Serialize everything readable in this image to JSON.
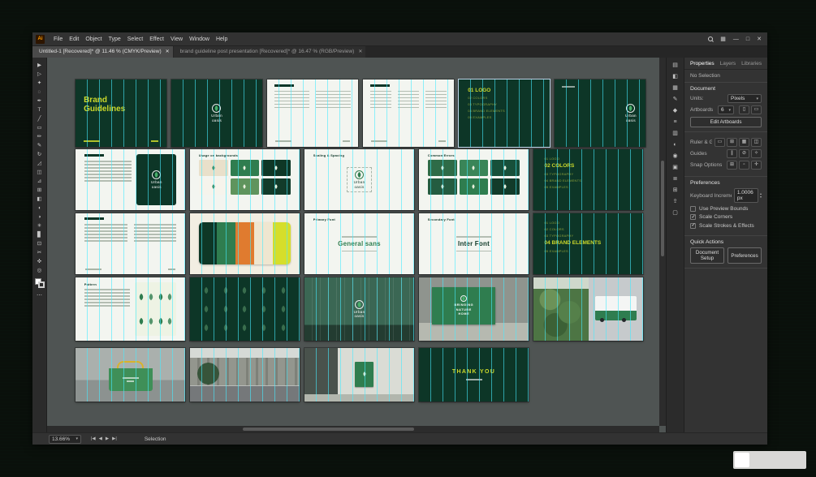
{
  "titlebar": {
    "app_icon_text": "Ai",
    "menus": [
      "File",
      "Edit",
      "Object",
      "Type",
      "Select",
      "Effect",
      "View",
      "Window",
      "Help"
    ]
  },
  "tabs": [
    {
      "label": "Untitled-1 [Recovered]* @ 11.46 % (CMYK/Preview)",
      "active": true
    },
    {
      "label": "brand guideline post presentation [Recovered]* @ 16.47 % (RGB/Preview)",
      "active": false
    }
  ],
  "toolbar": {
    "tools": [
      {
        "name": "selection-tool",
        "glyph": "▶"
      },
      {
        "name": "direct-selection-tool",
        "glyph": "▷"
      },
      {
        "name": "magic-wand-tool",
        "glyph": "✦"
      },
      {
        "name": "lasso-tool",
        "glyph": "◌"
      },
      {
        "name": "pen-tool",
        "glyph": "✒"
      },
      {
        "name": "type-tool",
        "glyph": "T"
      },
      {
        "name": "line-segment-tool",
        "glyph": "╱"
      },
      {
        "name": "rectangle-tool",
        "glyph": "▭"
      },
      {
        "name": "paintbrush-tool",
        "glyph": "✏"
      },
      {
        "name": "pencil-tool",
        "glyph": "✎"
      },
      {
        "name": "rotate-tool",
        "glyph": "↻"
      },
      {
        "name": "scale-tool",
        "glyph": "◿"
      },
      {
        "name": "shape-builder-tool",
        "glyph": "◫"
      },
      {
        "name": "perspective-grid-tool",
        "glyph": "⊿"
      },
      {
        "name": "mesh-tool",
        "glyph": "⊞"
      },
      {
        "name": "gradient-tool",
        "glyph": "◧"
      },
      {
        "name": "eyedropper-tool",
        "glyph": "◖"
      },
      {
        "name": "blend-tool",
        "glyph": "◑"
      },
      {
        "name": "symbol-sprayer-tool",
        "glyph": "✳"
      },
      {
        "name": "column-graph-tool",
        "glyph": "▊"
      },
      {
        "name": "artboard-tool",
        "glyph": "⊡"
      },
      {
        "name": "slice-tool",
        "glyph": "✂"
      },
      {
        "name": "hand-tool",
        "glyph": "✜"
      },
      {
        "name": "zoom-tool",
        "glyph": "◎"
      }
    ]
  },
  "dock_icons": [
    {
      "name": "color-panel-icon",
      "glyph": "▤"
    },
    {
      "name": "color-guide-panel-icon",
      "glyph": "◧"
    },
    {
      "name": "swatches-panel-icon",
      "glyph": "▦"
    },
    {
      "name": "brushes-panel-icon",
      "glyph": "✎"
    },
    {
      "name": "symbols-panel-icon",
      "glyph": "◆"
    },
    {
      "name": "stroke-panel-icon",
      "glyph": "≡"
    },
    {
      "name": "gradient-panel-icon",
      "glyph": "▥"
    },
    {
      "name": "transparency-panel-icon",
      "glyph": "◐"
    },
    {
      "name": "appearance-panel-icon",
      "glyph": "◉"
    },
    {
      "name": "graphic-styles-panel-icon",
      "glyph": "▣"
    },
    {
      "name": "layers-panel-icon",
      "glyph": "≣"
    },
    {
      "name": "artboards-panel-icon",
      "glyph": "⊞"
    },
    {
      "name": "asset-export-panel-icon",
      "glyph": "⇪"
    },
    {
      "name": "libraries-panel-icon",
      "glyph": "▢"
    }
  ],
  "panel": {
    "tabs": [
      "Properties",
      "Layers",
      "Libraries"
    ],
    "selection_status": "No Selection",
    "document": {
      "title": "Document",
      "units_label": "Units:",
      "units_value": "Pixels",
      "artboards_label": "Artboards",
      "artboards_value": "6",
      "artboard_icons": [
        {
          "name": "artboard-portrait-icon",
          "glyph": "▯"
        },
        {
          "name": "artboard-landscape-icon",
          "glyph": "▭"
        }
      ],
      "edit_artboards_label": "Edit Artboards"
    },
    "view": {
      "ruler_grids_label": "Ruler & Grids",
      "ruler_grids_icons": [
        {
          "name": "rulers-icon",
          "glyph": "▭"
        },
        {
          "name": "grid-icon",
          "glyph": "⊞"
        },
        {
          "name": "pixel-grid-icon",
          "glyph": "▦"
        },
        {
          "name": "transparency-grid-icon",
          "glyph": "◫"
        }
      ],
      "guides_label": "Guides",
      "guides_icons": [
        {
          "name": "show-guides-icon",
          "glyph": "∥"
        },
        {
          "name": "lock-guides-icon",
          "glyph": "⊘"
        },
        {
          "name": "smart-guides-icon",
          "glyph": "✧"
        }
      ],
      "snap_label": "Snap Options",
      "snap_icons": [
        {
          "name": "snap-to-grid-icon",
          "glyph": "⊞"
        },
        {
          "name": "snap-to-pixel-icon",
          "glyph": "▫"
        },
        {
          "name": "snap-to-point-icon",
          "glyph": "✛"
        }
      ]
    },
    "preferences": {
      "title": "Preferences",
      "keyboard_increment_label": "Keyboard Increment:",
      "keyboard_increment_value": "1.0006 px",
      "checkboxes": [
        {
          "label": "Use Preview Bounds",
          "checked": false
        },
        {
          "label": "Scale Corners",
          "checked": true
        },
        {
          "label": "Scale Strokes & Effects",
          "checked": true
        }
      ]
    },
    "quick_actions": {
      "title": "Quick Actions",
      "buttons": [
        "Document Setup",
        "Preferences"
      ]
    }
  },
  "statusbar": {
    "zoom": "13.66%",
    "status": "Selection"
  },
  "colors": {
    "desktop": "#0a100b",
    "chrome": "#323232",
    "canvas": "#4f5453",
    "brand_dark_green": "#0d3627",
    "brand_green": "#2f7d4f",
    "brand_yellow": "#ccd92b",
    "accent_orange": "#e07b2f",
    "guide_cyan": "#46ebff"
  },
  "brand": {
    "name_lines": [
      "Urban",
      "oasis"
    ],
    "sections": [
      "01 LOGO",
      "02 COLORS",
      "03 TYPOGRAPHY",
      "04 BRAND ELEMENTS",
      "05 EXAMPLES"
    ]
  },
  "usage_tiles": [
    "#e9e0ca",
    "#2f7d4f",
    "#0e3726",
    "#f6f4ec",
    "#5f945d",
    "#123b2a"
  ],
  "error_tiles": [
    "#2e6b47",
    "#3a8558",
    "#17503a",
    "#245c41",
    "#2f7d4f",
    "#123b2a"
  ],
  "swatch_colors": [
    "#0e3726",
    "#2f7d4f",
    "#e07b2f",
    "#efe6d0",
    "#d6de2a"
  ],
  "artboards": [
    {
      "id": "r1c1",
      "type": "title",
      "lines": [
        "Brand",
        "Guidelines"
      ]
    },
    {
      "id": "r1c2",
      "type": "logo_center"
    },
    {
      "id": "r1c3",
      "type": "doc_white",
      "columns": 2
    },
    {
      "id": "r1c4",
      "type": "doc_white",
      "columns": 3
    },
    {
      "id": "r1c5",
      "type": "divider",
      "active": 0,
      "selected": true
    },
    {
      "id": "r1c6",
      "type": "logo_right"
    },
    {
      "id": "r2c1",
      "type": "rationale"
    },
    {
      "id": "r2c2",
      "type": "usage",
      "title": "Usage on backgrounds"
    },
    {
      "id": "r2c3",
      "type": "scaling",
      "title": "Scaling & Spacing"
    },
    {
      "id": "r2c4",
      "type": "errors",
      "title": "Common Errors"
    },
    {
      "id": "r2c5",
      "type": "divider",
      "active": 1
    },
    {
      "id": "r3c1",
      "type": "doc_white",
      "columns": 2
    },
    {
      "id": "r3c2",
      "type": "swatches"
    },
    {
      "id": "r3c3",
      "type": "font_sample",
      "title": "Primary Font",
      "sample": "General sans",
      "sample_color": "#2f7d4f"
    },
    {
      "id": "r3c4",
      "type": "font_sample",
      "title": "Secondary Font",
      "sample": "Inter Font",
      "sample_color": "#0e3726"
    },
    {
      "id": "r3c5",
      "type": "divider",
      "active": 3
    },
    {
      "id": "r4c1",
      "type": "pattern_light",
      "title": "Pattern"
    },
    {
      "id": "r4c2",
      "type": "pattern_dark"
    },
    {
      "id": "r4c3",
      "type": "photo_building"
    },
    {
      "id": "r4c4",
      "type": "photo_billboard",
      "lines": [
        "BRINGING",
        "NATURE",
        "HOME"
      ]
    },
    {
      "id": "r4c5",
      "type": "photo_collage"
    },
    {
      "id": "r5c1",
      "type": "photo_tote"
    },
    {
      "id": "r5c2",
      "type": "photo_street"
    },
    {
      "id": "r5c3",
      "type": "photo_sign"
    },
    {
      "id": "r5c4",
      "type": "thank_you",
      "text": "THANK YOU"
    }
  ]
}
